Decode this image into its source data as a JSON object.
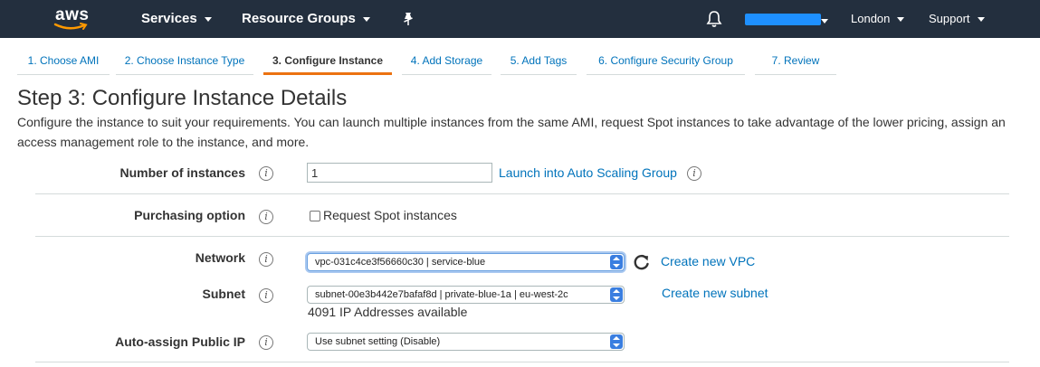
{
  "nav": {
    "logo_text": "aws",
    "services": "Services",
    "resource_groups": "Resource Groups",
    "region": "London",
    "support": "Support"
  },
  "wizard": {
    "tabs": [
      {
        "label": "1. Choose AMI",
        "active": false
      },
      {
        "label": "2. Choose Instance Type",
        "active": false
      },
      {
        "label": "3. Configure Instance",
        "active": true
      },
      {
        "label": "4. Add Storage",
        "active": false
      },
      {
        "label": "5. Add Tags",
        "active": false
      },
      {
        "label": "6. Configure Security Group",
        "active": false
      },
      {
        "label": "7. Review",
        "active": false
      }
    ]
  },
  "page": {
    "title": "Step 3: Configure Instance Details",
    "description": "Configure the instance to suit your requirements. You can launch multiple instances from the same AMI, request Spot instances to take advantage of the lower pricing, assign an access management role to the instance, and more."
  },
  "form": {
    "instances": {
      "label": "Number of instances",
      "value": "1",
      "link": "Launch into Auto Scaling Group"
    },
    "purchasing": {
      "label": "Purchasing option",
      "checkbox_label": "Request Spot instances",
      "checked": false
    },
    "network": {
      "label": "Network",
      "value": "vpc-031c4ce3f56660c30 | service-blue",
      "link": "Create new VPC"
    },
    "subnet": {
      "label": "Subnet",
      "value": "subnet-00e3b442e7bafaf8d | private-blue-1a | eu-west-2c",
      "link": "Create new subnet",
      "note": "4091 IP Addresses available"
    },
    "public_ip": {
      "label": "Auto-assign Public IP",
      "value": "Use subnet setting (Disable)"
    }
  },
  "colors": {
    "nav_bg": "#232f3e",
    "link": "#0073bb",
    "active_tab": "#ec7211",
    "account_redaction": "#1e90ff"
  },
  "icons": {
    "info": "info-icon",
    "refresh": "refresh-icon",
    "pin": "pin-icon",
    "bell": "bell-icon"
  }
}
